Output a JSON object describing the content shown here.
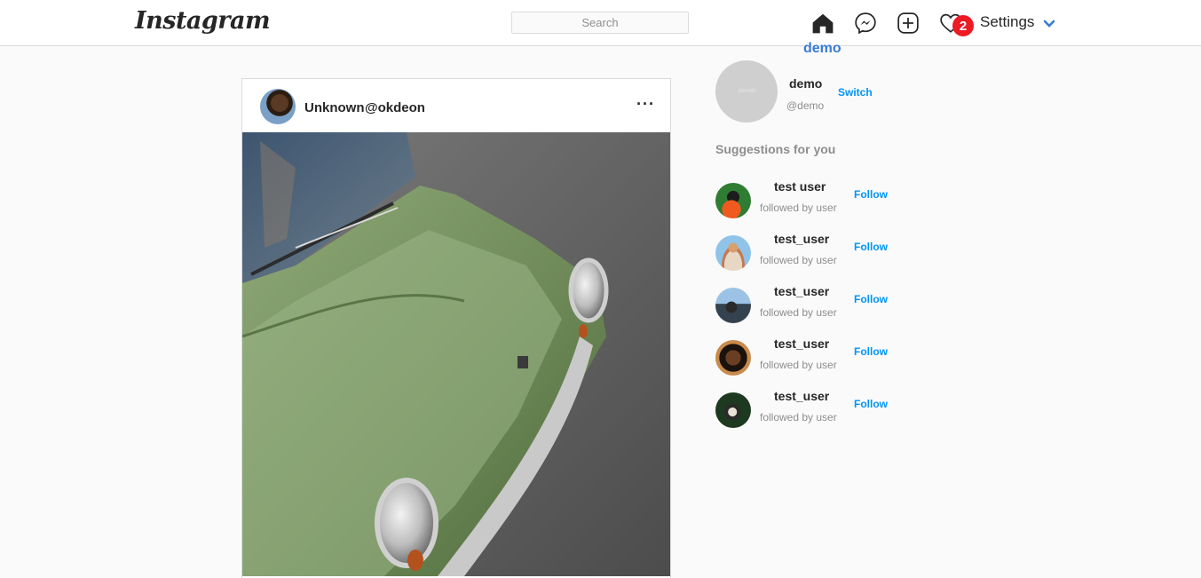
{
  "header": {
    "logo": "Instagram",
    "search_placeholder": "Search",
    "notification_count": "2",
    "settings_label": "Settings"
  },
  "post": {
    "username": "Unknown",
    "handle": "@okdeon",
    "more_label": "···"
  },
  "sidebar": {
    "title": "demo",
    "avatar_placeholder": "150×150",
    "user_name": "demo",
    "user_handle": "@demo",
    "switch_label": "Switch",
    "suggestions_title": "Suggestions for you",
    "suggestions": [
      {
        "name": "test user",
        "subtitle": "followed by user",
        "action": "Follow"
      },
      {
        "name": "test_user",
        "subtitle": "followed by user",
        "action": "Follow"
      },
      {
        "name": "test_user",
        "subtitle": "followed by user",
        "action": "Follow"
      },
      {
        "name": "test_user",
        "subtitle": "followed by user",
        "action": "Follow"
      },
      {
        "name": "test_user",
        "subtitle": "followed by user",
        "action": "Follow"
      }
    ]
  },
  "colors": {
    "accent": "#0095f6",
    "title_blue": "#3a7bd5",
    "badge": "#ed1a24",
    "border": "#dbdbdb",
    "background": "#fafafa"
  },
  "icons": [
    "home-icon",
    "messenger-icon",
    "new-post-icon",
    "heart-icon",
    "chevron-down-icon",
    "more-icon"
  ]
}
